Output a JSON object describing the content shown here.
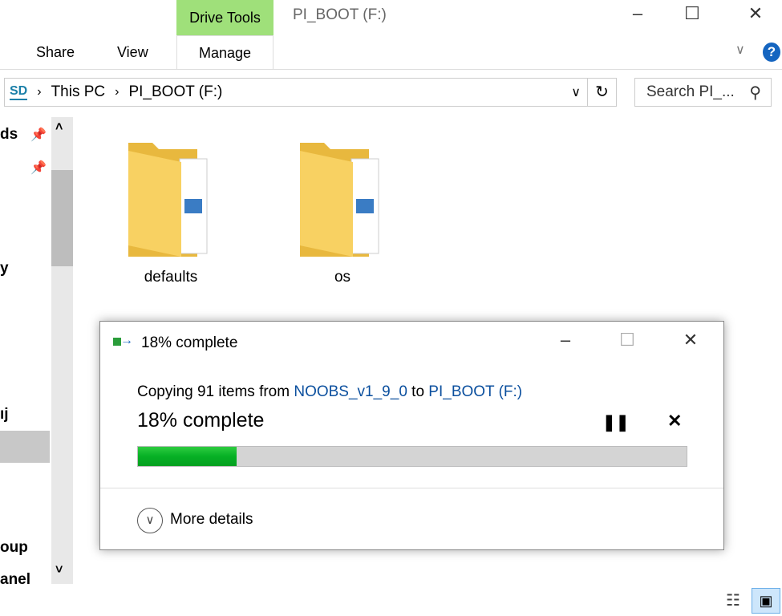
{
  "window": {
    "title": "PI_BOOT (F:)",
    "context_tab": "Drive Tools"
  },
  "ribbon": {
    "tabs": [
      "Share",
      "View",
      "Manage"
    ]
  },
  "address": {
    "crumbs": [
      "This PC",
      "PI_BOOT (F:)"
    ],
    "drive_icon": "sd-card-icon"
  },
  "search": {
    "placeholder": "Search PI_..."
  },
  "nav": {
    "items": [
      "ds",
      "y",
      "ıj",
      "oup",
      "anel"
    ]
  },
  "folders": [
    {
      "name": "defaults"
    },
    {
      "name": "os"
    }
  ],
  "dialog": {
    "title": "18% complete",
    "copy_prefix": "Copying 91 items from ",
    "source": "NOOBS_v1_9_0",
    "mid": " to ",
    "dest": "PI_BOOT (F:)",
    "status": "18% complete",
    "progress_percent": 18,
    "more_details": "More details",
    "progress_color": "#06b025"
  }
}
